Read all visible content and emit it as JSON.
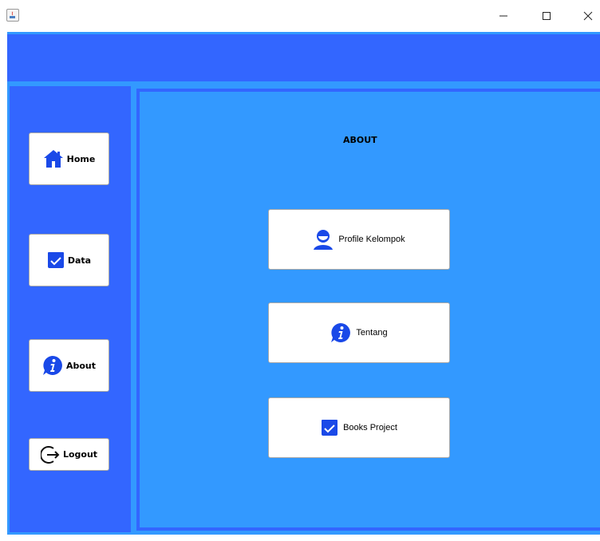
{
  "window": {
    "controls": {
      "minimize": "—",
      "maximize": "☐",
      "close": "✕"
    }
  },
  "sidebar": {
    "items": [
      {
        "label": "Home",
        "icon": "home-icon"
      },
      {
        "label": "Data",
        "icon": "checkbox-icon"
      },
      {
        "label": "About",
        "icon": "info-icon"
      },
      {
        "label": "Logout",
        "icon": "logout-icon"
      }
    ]
  },
  "main": {
    "title": "ABOUT",
    "buttons": [
      {
        "label": "Profile Kelompok",
        "icon": "user-icon"
      },
      {
        "label": "Tentang",
        "icon": "info-icon"
      },
      {
        "label": "Books Project",
        "icon": "checkbox-icon"
      }
    ]
  },
  "colors": {
    "frame": "#3399ff",
    "panel": "#3366ff",
    "icon": "#1a49e8"
  }
}
